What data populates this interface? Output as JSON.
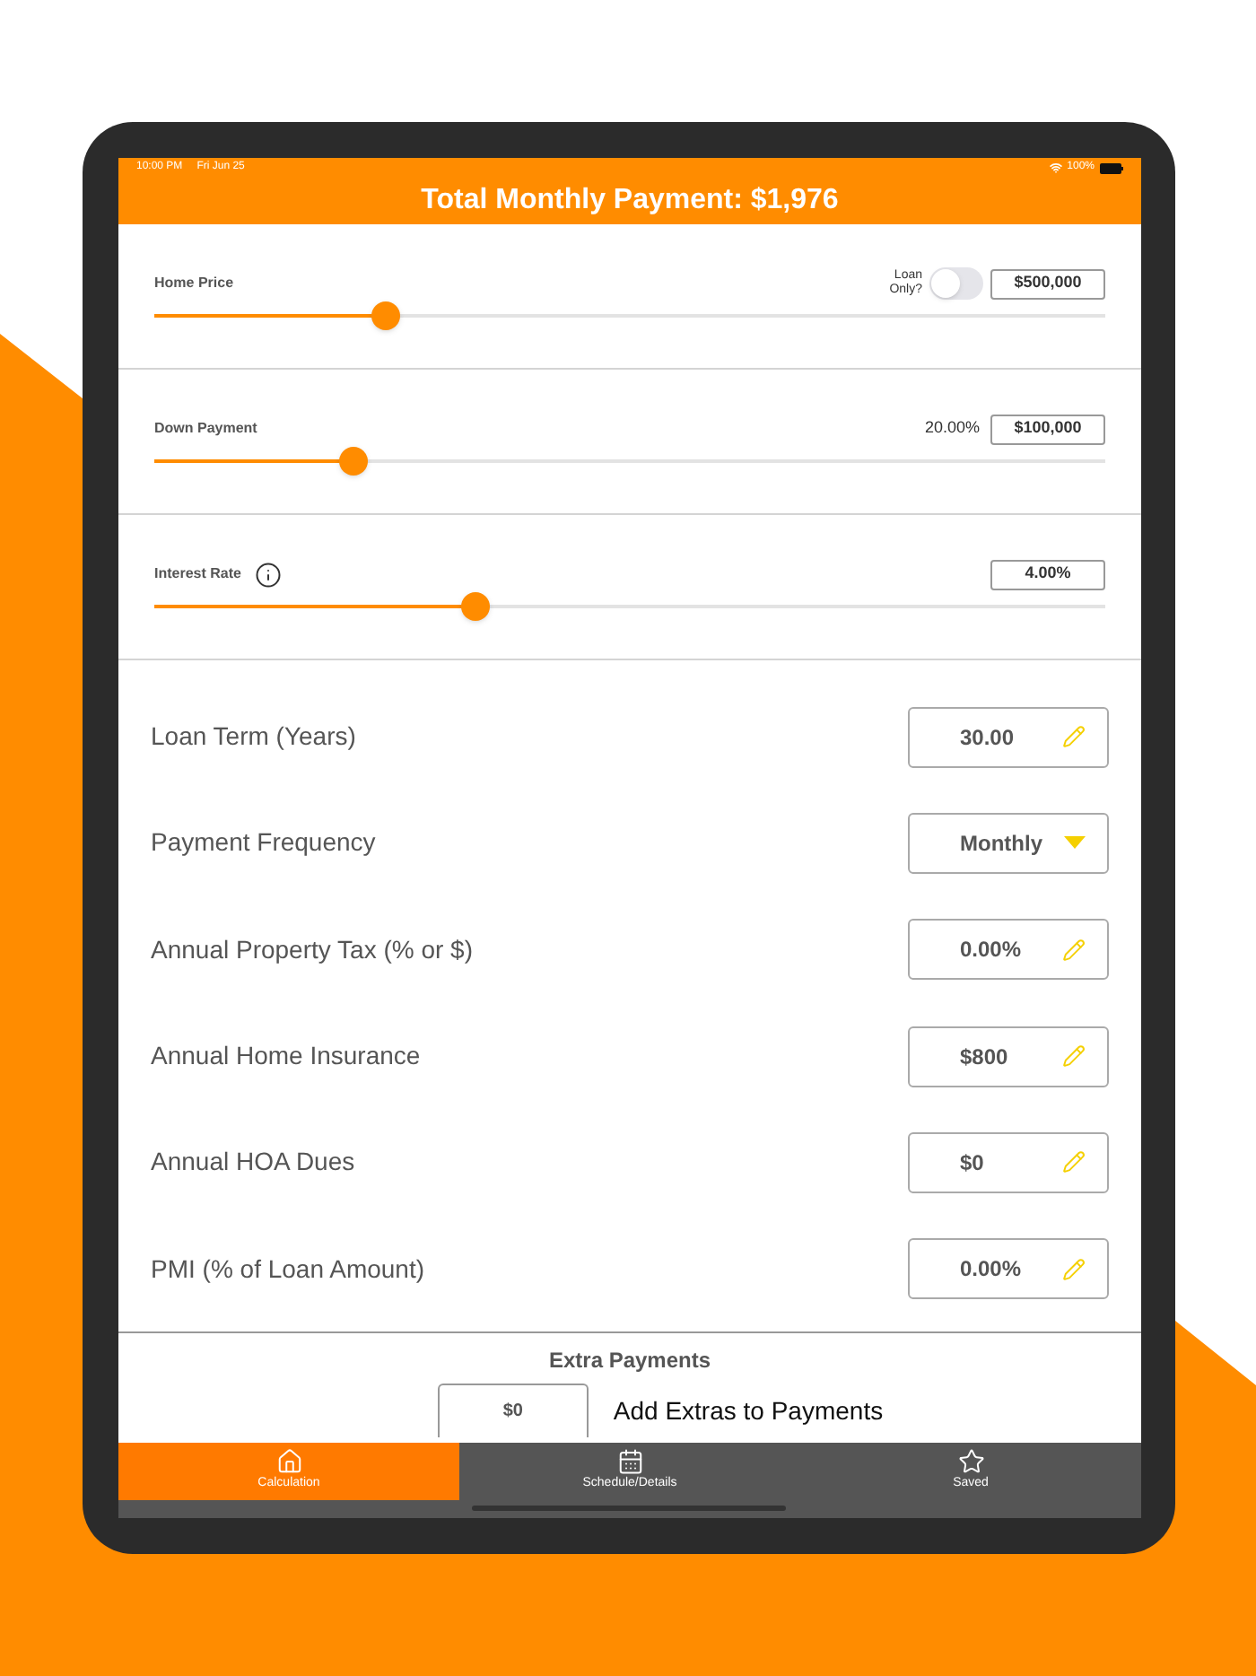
{
  "status_bar": {
    "time": "10:00 PM",
    "date": "Fri Jun 25",
    "battery": "100%"
  },
  "header": {
    "title": "Total Monthly Payment: $1,976"
  },
  "sliders": [
    {
      "kind": "toggle",
      "label": "Home Price",
      "value": "$500,000",
      "level": 0.244,
      "toggle": {
        "label": "Loan Only?",
        "on": false
      }
    },
    {
      "kind": "percent",
      "label": "Down Payment",
      "value": "$100,000",
      "level": 0.21,
      "percent": "20.00%"
    },
    {
      "kind": "info",
      "label": "Interest Rate",
      "value": "4.00%",
      "level": 0.338
    }
  ],
  "fields": [
    {
      "kind": "edit",
      "label": "Loan Term (Years)",
      "value": "30.00"
    },
    {
      "kind": "dropdown",
      "label": "Payment Frequency",
      "value": "Monthly"
    },
    {
      "kind": "edit",
      "label": "Annual Property Tax (% or $)",
      "value": "0.00%"
    },
    {
      "kind": "edit",
      "label": "Annual Home Insurance",
      "value": "$800"
    },
    {
      "kind": "edit",
      "label": "Annual HOA Dues",
      "value": "$0"
    },
    {
      "kind": "edit",
      "label": "PMI (% of Loan Amount)",
      "value": "0.00%"
    }
  ],
  "extra_payments": {
    "title": "Extra Payments",
    "value": "$0",
    "label": "Add Extras to Payments"
  },
  "tabs": [
    {
      "label": "Calculation",
      "selected": true
    },
    {
      "label": "Schedule/Details",
      "selected": false
    },
    {
      "label": "Saved",
      "selected": false
    }
  ]
}
